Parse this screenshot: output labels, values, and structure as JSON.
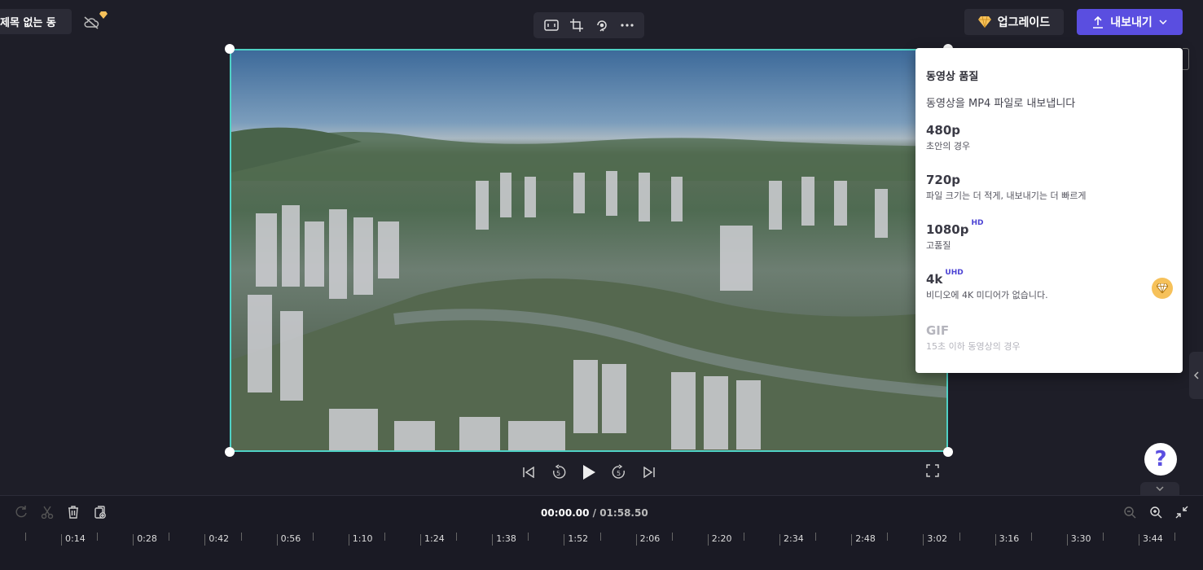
{
  "header": {
    "project_title": "제목 없는 동",
    "upgrade_label": "업그레이드",
    "export_label": "내보내기"
  },
  "export_menu": {
    "heading": "동영상 품질",
    "subtitle": "동영상을 MP4 파일로 내보냅니다",
    "options": [
      {
        "name": "480p",
        "badge": "",
        "desc": "초안의 경우",
        "disabled": false
      },
      {
        "name": "720p",
        "badge": "",
        "desc": "파일 크기는 더 적게, 내보내기는 더 빠르게",
        "disabled": false
      },
      {
        "name": "1080p",
        "badge": "HD",
        "desc": "고품질",
        "disabled": false
      },
      {
        "name": "4k",
        "badge": "UHD",
        "desc": "비디오에 4K 미디어가 없습니다.",
        "disabled": false
      },
      {
        "name": "GIF",
        "badge": "",
        "desc": "15초 이하 동영상의 경우",
        "disabled": true
      }
    ]
  },
  "help_label": "?",
  "timeline": {
    "current_time": "00:00.00",
    "total_time": "/ 01:58.50",
    "ruler_labels": [
      "0:14",
      "0:28",
      "0:42",
      "0:56",
      "1:10",
      "1:24",
      "1:38",
      "1:52",
      "2:06",
      "2:20",
      "2:34",
      "2:48",
      "3:02",
      "3:16",
      "3:30",
      "3:44"
    ]
  },
  "colors": {
    "accent": "#5a4ee0",
    "selection_border": "#4fd1c5",
    "premium": "#f6c15a",
    "badge": "#4c43d4"
  },
  "icons": {
    "cloud_status": "cloud-off-icon",
    "toolbar": [
      "fit-icon",
      "crop-icon",
      "rotate-icon",
      "more-icon"
    ],
    "playback": [
      "skip-back-icon",
      "rewind-5-icon",
      "play-icon",
      "forward-5-icon",
      "skip-forward-icon"
    ]
  }
}
